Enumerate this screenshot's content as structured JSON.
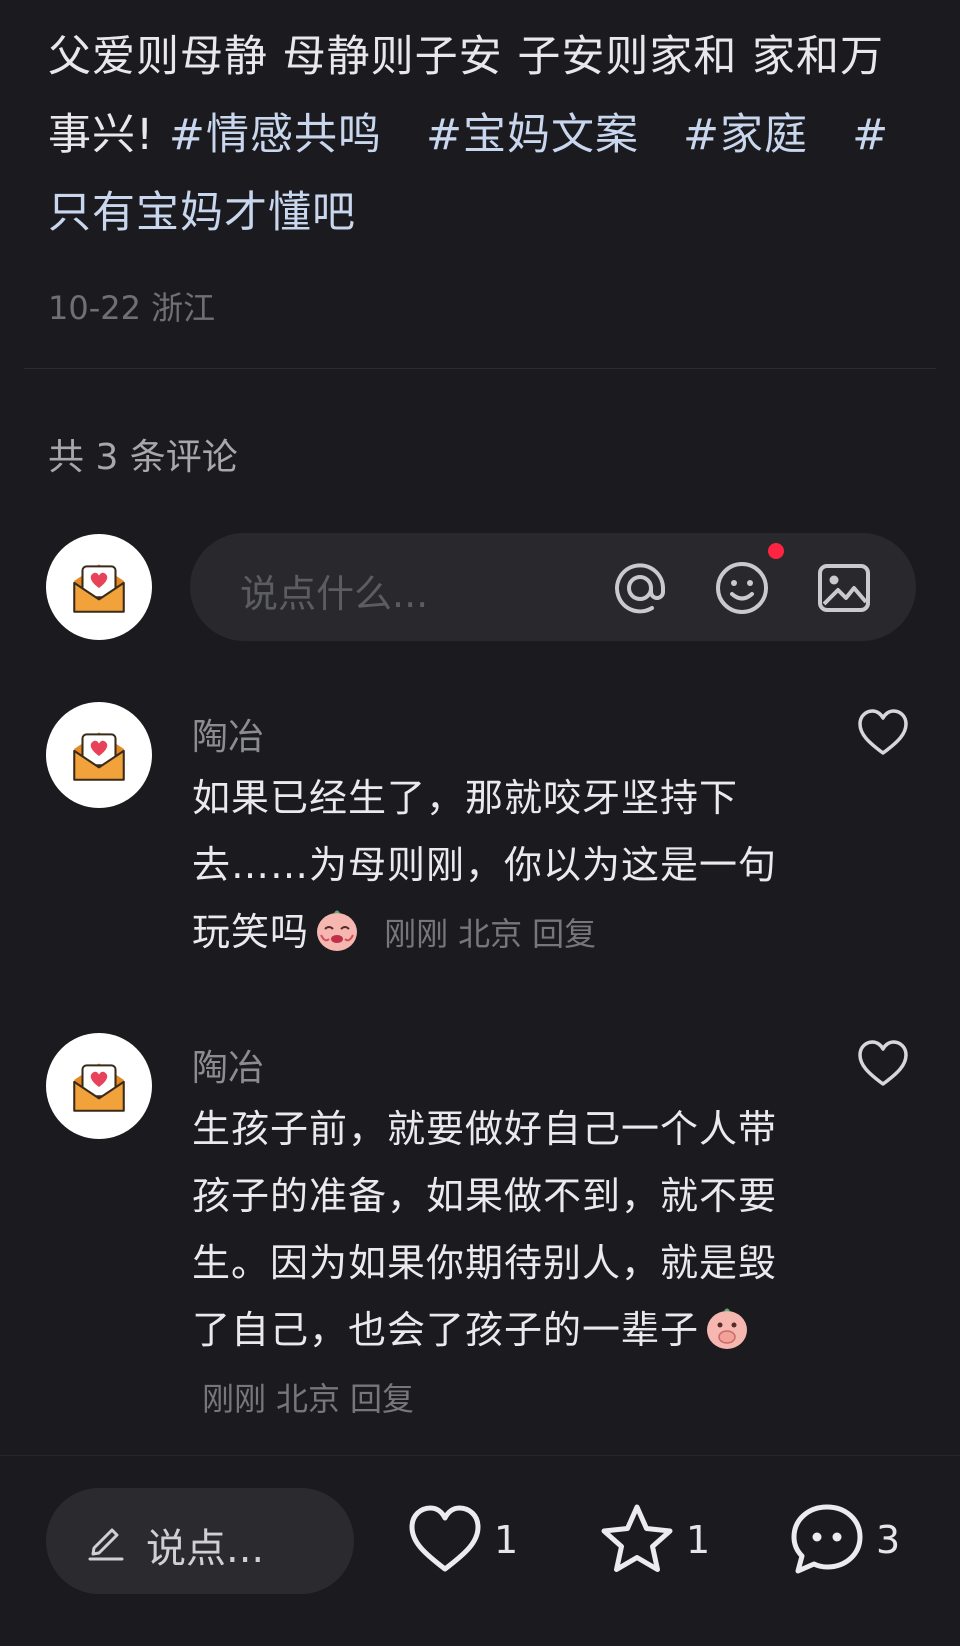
{
  "post": {
    "text": "父爱则母静 母静则子安 子安则家和 家和万事兴!",
    "tags": [
      "#情感共鸣",
      "#宝妈文案",
      "#家庭",
      "#只有宝妈才懂吧"
    ],
    "date": "10-22",
    "location": "浙江"
  },
  "comments_header": {
    "count_text": "共 3 条评论"
  },
  "comment_input": {
    "placeholder": "说点什么...",
    "icons": [
      "at-icon",
      "emoji-icon",
      "image-icon"
    ],
    "badge_color": "#ff2442"
  },
  "comments": [
    {
      "name": "陶冶",
      "text": "如果已经生了，那就咬牙坚持下去……为母则刚，你以为这是一句玩笑吗",
      "emoji": "crying-emoji",
      "time": "刚刚",
      "location": "北京",
      "reply": "回复"
    },
    {
      "name": "陶冶",
      "text": "生孩子前，就要做好自己一个人带孩子的准备，如果做不到，就不要生。因为如果你期待别人，就是毁了自己，也会了孩子的一辈子",
      "emoji": "covering-mouth-emoji",
      "time": "刚刚",
      "location": "北京",
      "reply": "回复"
    }
  ],
  "bottom_bar": {
    "input_label": "说点...",
    "likes": "1",
    "stars": "1",
    "comments": "3"
  },
  "colors": {
    "background": "#1b1b1f",
    "tag": "#c8d6ee",
    "accent_red": "#ff2442",
    "avatar_envelope": "#f2a23a"
  }
}
